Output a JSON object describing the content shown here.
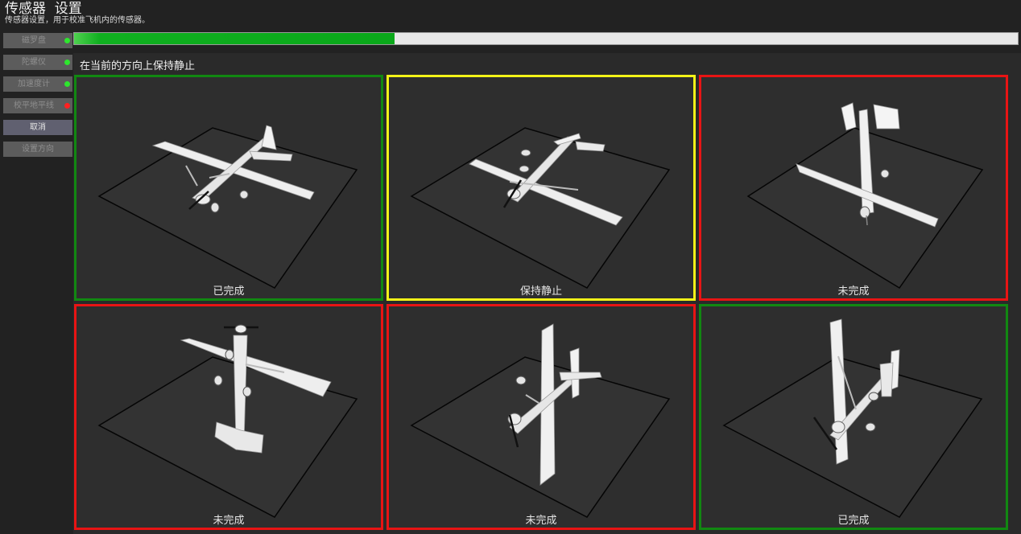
{
  "header": {
    "title": "传感器  设置",
    "subtitle": "传感器设置，用于校准飞机内的传感器。"
  },
  "sidebar": {
    "items": [
      {
        "label": "磁罗盘",
        "status": "green"
      },
      {
        "label": "陀螺仪",
        "status": "green"
      },
      {
        "label": "加速度计",
        "status": "green"
      },
      {
        "label": "校平地平线",
        "status": "red"
      },
      {
        "label": "取消",
        "active": true
      },
      {
        "label": "设置方向"
      }
    ]
  },
  "progress": {
    "value": 0.34
  },
  "instruction": "在当前的方向上保持静止",
  "colors": {
    "green": "#118811",
    "yellow": "#f4f418",
    "red": "#e81414",
    "dot_green": "#2ee62e",
    "dot_red": "#ff2020"
  },
  "orientations": [
    {
      "label": "已完成",
      "status": "green",
      "icon": "plane-level"
    },
    {
      "label": "保持静止",
      "status": "yellow",
      "icon": "plane-inverted"
    },
    {
      "label": "未完成",
      "status": "red",
      "icon": "plane-nose-down"
    },
    {
      "label": "未完成",
      "status": "red",
      "icon": "plane-nose-up"
    },
    {
      "label": "未完成",
      "status": "red",
      "icon": "plane-left-side"
    },
    {
      "label": "已完成",
      "status": "green",
      "icon": "plane-right-side"
    }
  ]
}
